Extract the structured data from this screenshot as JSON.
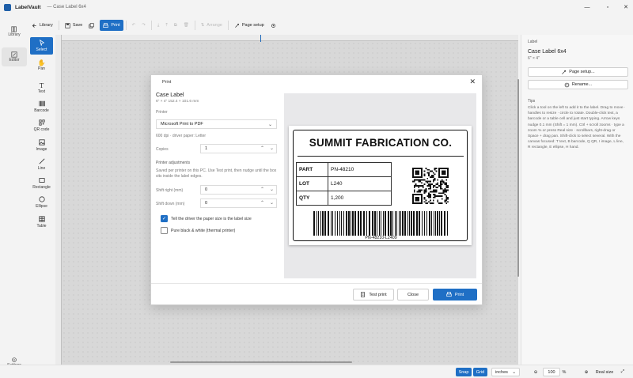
{
  "app": {
    "name": "LabelVault",
    "document": "— Case Label 6x4"
  },
  "toolbar": {
    "library": "Library",
    "save": "Save",
    "print": "Print",
    "arrange": "Arrange",
    "page_setup": "Page setup"
  },
  "rail": {
    "library": "Library",
    "editor": "Editor",
    "settings": "Settings"
  },
  "tools": [
    "Select",
    "Pan",
    "Text",
    "Barcode",
    "QR code",
    "Image",
    "Line",
    "Rectangle",
    "Ellipse",
    "Table"
  ],
  "panel": {
    "section": "Label",
    "title": "Case Label 6x4",
    "size": "6\" × 4\"",
    "page_setup": "Page setup...",
    "rename": "Rename...",
    "tips_header": "Tips",
    "tips": "Click a tool on the left to add it to the label. Drag to move · handles to resize · circle to rotate. Double-click text, a barcode or a table cell and just start typing. Arrow keys nudge 0.1 mm (Shift = 1 mm). Ctrl + scroll zooms · type a zoom % or press Real size · scrollbars, right-drag or Space + drag pan. Shift-click to select several. With the canvas focused: T text, B barcode, Q QR, I image, L line, R rectangle, E ellipse, H hand."
  },
  "status": {
    "snap": "Snap",
    "grid": "Grid",
    "units": "inches",
    "zoom": "100",
    "zoom_unit": "%",
    "real_size": "Real size"
  },
  "dialog": {
    "title": "Print",
    "label_name": "Case Label",
    "label_dims": "6\" × 4\"   152.4 × 101.6 mm",
    "printer_label": "Printer",
    "printer_value": "Microsoft Print to PDF",
    "printer_info": "600 dpi · driver paper: Letter",
    "copies_label": "Copies",
    "copies_value": "1",
    "adjust_header": "Printer adjustments",
    "adjust_desc": "Saved per printer on this PC. Use Test print, then nudge until the box sits inside the label edges.",
    "shift_right_label": "Shift right (mm)",
    "shift_right_value": "0",
    "shift_down_label": "Shift down (mm)",
    "shift_down_value": "0",
    "opt_driver_size": "Tell the driver the paper size is the label size",
    "opt_driver_size_checked": true,
    "opt_bw": "Pure black & white (thermal printer)",
    "opt_bw_checked": false,
    "btn_test": "Test print",
    "btn_close": "Close",
    "btn_print": "Print"
  },
  "label": {
    "company": "SUMMIT FABRICATION CO.",
    "rows": [
      {
        "key": "PART",
        "value": "PN-48210"
      },
      {
        "key": "LOT",
        "value": "L240"
      },
      {
        "key": "QTY",
        "value": "1,200"
      }
    ],
    "barcode_text": "PN-48210-L2409"
  },
  "colors": {
    "accent": "#1f6fc5",
    "canvas": "#e6e6e6"
  }
}
